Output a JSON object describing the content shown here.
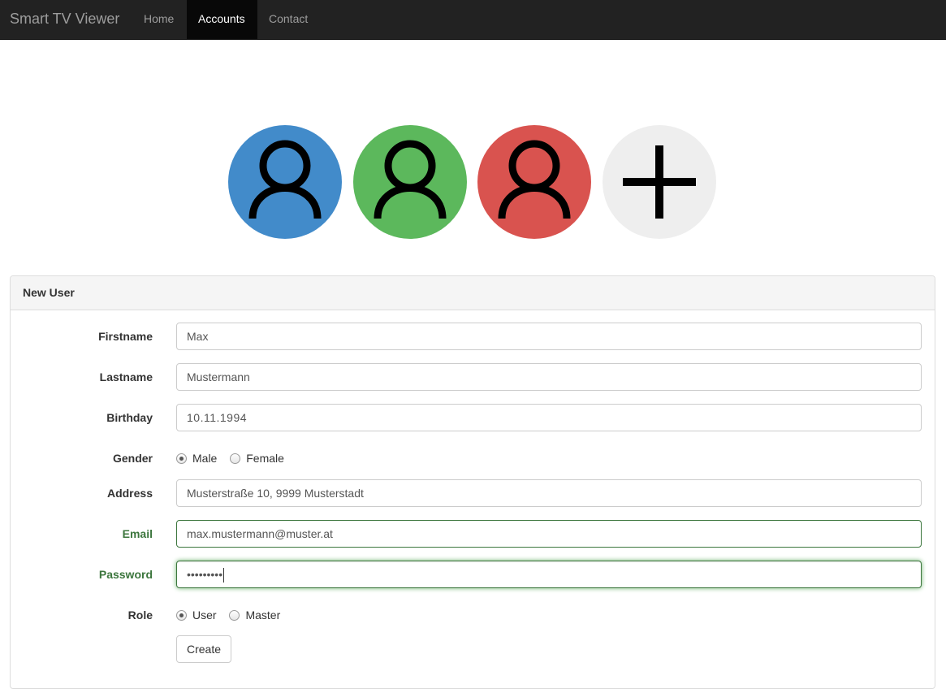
{
  "colors": {
    "blue": "#428bca",
    "green": "#5cb85c",
    "red": "#d9534f",
    "grey": "#eeeeee",
    "success": "#3c763d"
  },
  "navbar": {
    "brand": "Smart TV Viewer",
    "items": [
      {
        "label": "Home",
        "active": false
      },
      {
        "label": "Accounts",
        "active": true
      },
      {
        "label": "Contact",
        "active": false
      }
    ]
  },
  "avatars": [
    {
      "icon": "user-icon",
      "color": "blue"
    },
    {
      "icon": "user-icon",
      "color": "green"
    },
    {
      "icon": "user-icon",
      "color": "red"
    },
    {
      "icon": "plus-icon",
      "color": "grey"
    }
  ],
  "form": {
    "heading": "New User",
    "firstname": {
      "label": "Firstname",
      "value": "Max"
    },
    "lastname": {
      "label": "Lastname",
      "value": "Mustermann"
    },
    "birthday": {
      "label": "Birthday",
      "value": "10.11.1994"
    },
    "gender": {
      "label": "Gender",
      "options": [
        "Male",
        "Female"
      ],
      "selected": "Male"
    },
    "address": {
      "label": "Address",
      "value": "Musterstraße 10, 9999 Musterstadt"
    },
    "email": {
      "label": "Email",
      "value": "max.mustermann@muster.at"
    },
    "password": {
      "label": "Password",
      "value": "•••••••••"
    },
    "role": {
      "label": "Role",
      "options": [
        "User",
        "Master"
      ],
      "selected": "User"
    },
    "submit_label": "Create"
  }
}
